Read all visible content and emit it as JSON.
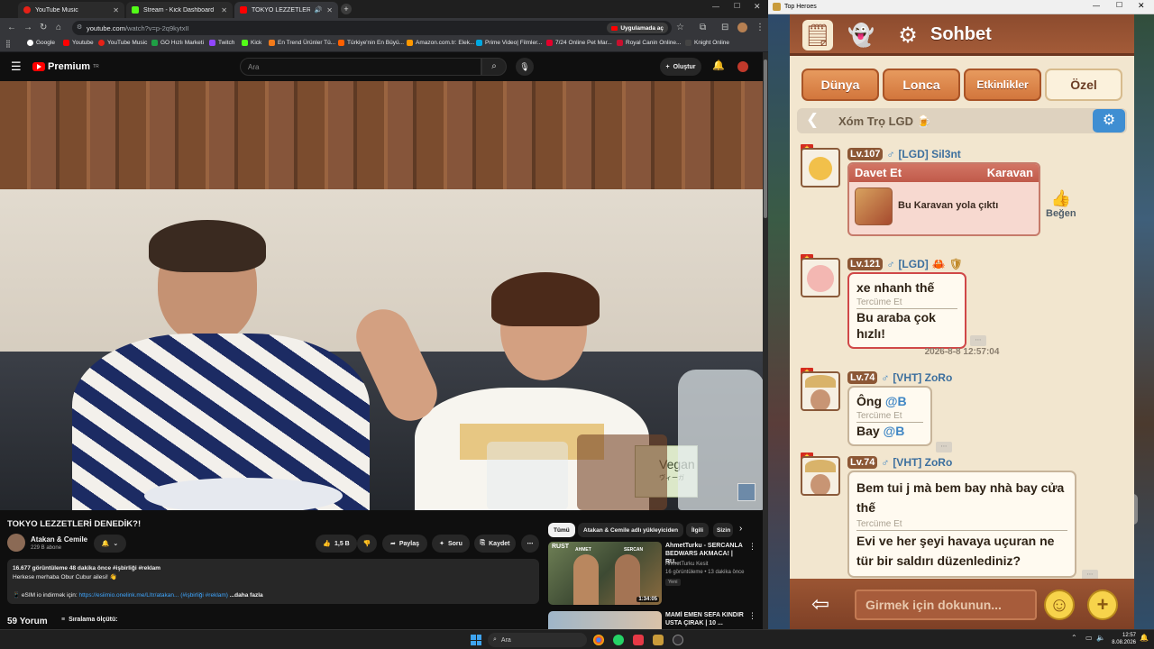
{
  "browser": {
    "tabs": [
      {
        "title": "YouTube Music",
        "color": "#e62117"
      },
      {
        "title": "Stream - Kick Dashboard",
        "color": "#53fc18"
      },
      {
        "title": "TOKYO LEZZETLERİ DENEDİ",
        "color": "#ff0000"
      }
    ],
    "url_host": "youtube.com",
    "url_path": "/watch?v=p-2q9kytxII",
    "app_button": "Uygulamada aç",
    "bookmarks": [
      "Google",
      "Youtube",
      "YouTube Music",
      "GO Hızlı Marketi",
      "Twitch",
      "Kick",
      "En Trend Ürünler Tü...",
      "Türkiye'nin En Büyü...",
      "Amazon.com.tr: Elek...",
      "Prime Video| Filmler...",
      "7/24 Online Pet Mar...",
      "Royal Canin Online...",
      "Knight Online"
    ]
  },
  "youtube": {
    "logo": "Premium",
    "logo_sup": "TR",
    "search_placeholder": "Ara",
    "create_label": "Oluştur",
    "video_overlay": {
      "sign": "Vegan",
      "sign_sub": "ヴィーガ"
    },
    "video_title": "TOKYO LEZZETLERİ DENEDİK?!",
    "channel_name": "Atakan & Cemile",
    "subscribers": "229 B abone",
    "likes": "1,5 B",
    "share": "Paylaş",
    "ask": "Soru",
    "save": "Kaydet",
    "views_line": "16.677 görüntüleme  48 dakika önce  #işbirliği #reklam",
    "desc_line1": "Herkese merhaba Obur Cubur ailesi! 👋",
    "desc_line2_prefix": "📱 eSIM io indirmek için: ",
    "desc_link": "https://esiimio.onelink.me/LItr/atakan...",
    "desc_tags": "(#işbirliği #reklam)",
    "desc_more": "...daha fazla",
    "comments": "59 Yorum",
    "sort": "Sıralama ölçütü:",
    "chips": [
      "Tümü",
      "Atakan & Cemile adlı yükleyiciden",
      "İlgili",
      "Sizin"
    ],
    "reco": [
      {
        "title": "AhmetTurku - SERCANLA BEDWARS AKMACA! | RU...",
        "channel": "AhmetTurku Kesit",
        "meta": "16 görüntüleme • 13 dakika önce",
        "badge": "Yeni",
        "duration": "1:34:05",
        "thumb_top": "RUST",
        "thumb_left": "AHMET",
        "thumb_right": "SERCAN"
      },
      {
        "title": "MAMİ EMEN SEFA KINDIR USTA ÇIRAK | 10 ...",
        "channel": "",
        "meta": "",
        "badge": "",
        "duration": "",
        "thumb_top": "",
        "thumb_left": "",
        "thumb_right": ""
      }
    ]
  },
  "game": {
    "window_title": "Top Heroes",
    "chat_title": "Sohbet",
    "tabs": [
      "Dünya",
      "Lonca",
      "Etkinlikler",
      "Özel"
    ],
    "channel": "Xóm Trọ LGD 🍺",
    "messages": [
      {
        "level": "Lv.107",
        "guild": "[LGD] Sil3nt",
        "type": "invite",
        "invite_left": "Davet Et",
        "invite_right": "Karavan",
        "invite_text": "Bu Karavan yola çıktı",
        "like": "Beğen"
      },
      {
        "level": "Lv.121",
        "guild": "[LGD]",
        "text": "xe nhanh thế",
        "translate": "Tercüme Et",
        "translation": "Bu araba çok hızlı!"
      },
      {
        "level": "Lv.74",
        "guild": "[VHT] ZoRo",
        "text_a": "Ông ",
        "text_a_mention": "@B",
        "translate": "Tercüme Et",
        "translation_a": "Bay ",
        "translation_mention": "@B"
      },
      {
        "level": "Lv.74",
        "guild": "[VHT] ZoRo",
        "text": "Bem tui j mà bem bay nhà bay cửa thế",
        "translate": "Tercüme Et",
        "translation": "Evi ve her şeyi havaya uçuran ne tür bir saldırı düzenlediniz?"
      }
    ],
    "timestamp": "2026-8-8  12:57:04",
    "input_placeholder": "Girmek için dokunun..."
  },
  "taskbar": {
    "search": "Ara",
    "time": "12:57",
    "date": "8.08.2026"
  }
}
